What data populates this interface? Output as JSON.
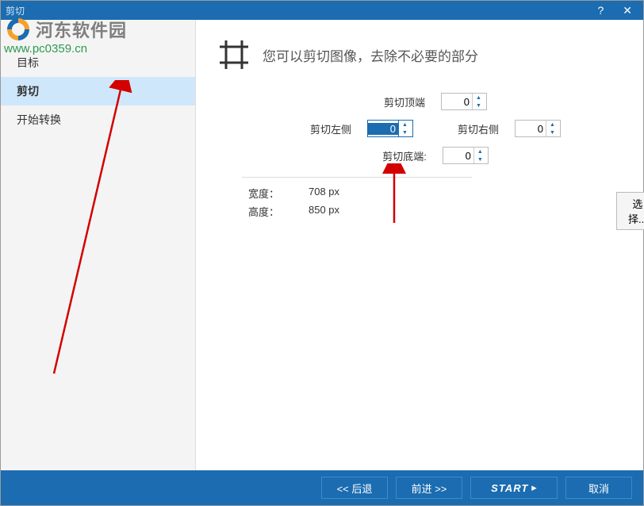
{
  "titlebar": {
    "title": "剪切"
  },
  "watermark": {
    "text": "河东软件园",
    "url": "www.pc0359.cn"
  },
  "sidebar": {
    "items": [
      {
        "label": "目标"
      },
      {
        "label": "剪切"
      },
      {
        "label": "开始转换"
      }
    ]
  },
  "content": {
    "header_text": "您可以剪切图像，去除不必要的部分",
    "crop": {
      "top_label": "剪切顶端",
      "top_value": "0",
      "left_label": "剪切左侧",
      "left_value": "0",
      "right_label": "剪切右侧",
      "right_value": "0",
      "bottom_label": "剪切底端:",
      "bottom_value": "0"
    },
    "info": {
      "width_label": "宽度：",
      "width_value": "708 px",
      "height_label": "高度：",
      "height_value": "850 px"
    },
    "select_btn": "选择..."
  },
  "footer": {
    "back": "<< 后退",
    "forward": "前进 >>",
    "start": "START",
    "start_arrow": "▸",
    "cancel": "取消"
  }
}
